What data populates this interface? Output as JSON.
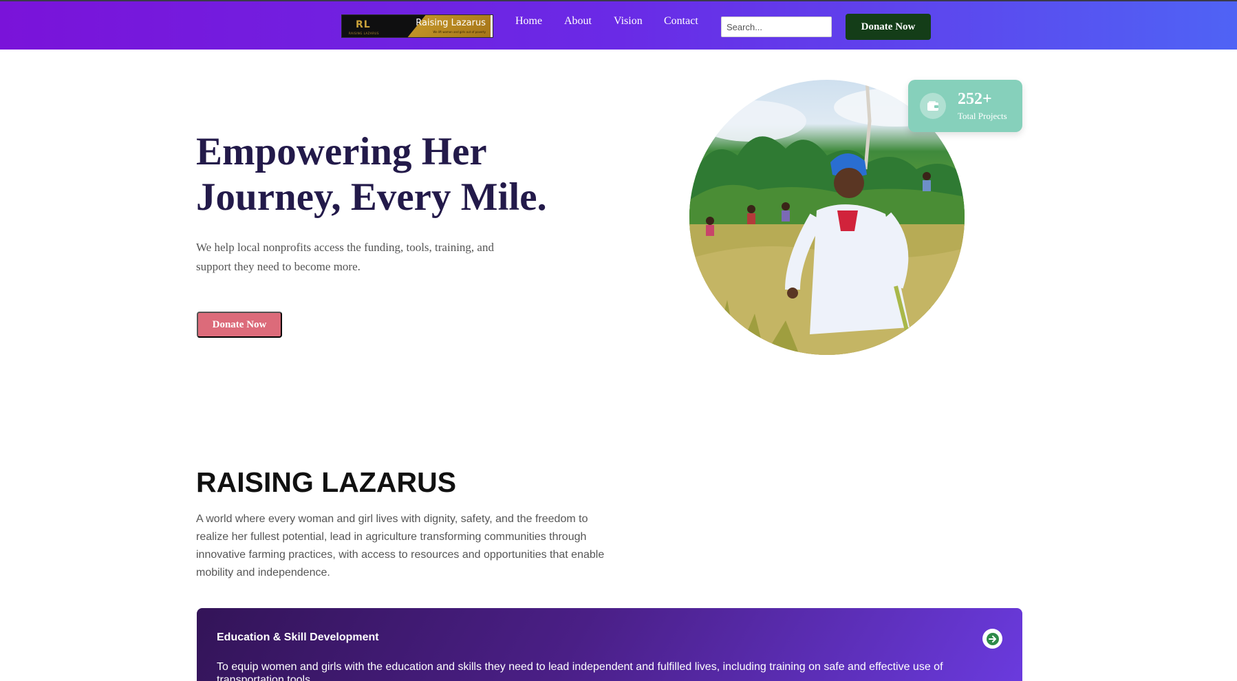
{
  "header": {
    "logo": {
      "mark": "RL",
      "mark_sub": "RAISING LAZARUS",
      "name": "Raising Lazarus",
      "tagline": "We lift women and girls out of poverty"
    },
    "nav": [
      "Home",
      "About",
      "Vision",
      "Contact"
    ],
    "search_placeholder": "Search...",
    "donate_label": "Donate Now"
  },
  "hero": {
    "title_line1": "Empowering Her",
    "title_line2": "Journey, Every Mile.",
    "subtitle_line1": "We help local nonprofits access the funding, tools, training, and",
    "subtitle_line2": "support they need to become more.",
    "donate_label": "Donate Now",
    "image_icon": "woman-in-rice-field-photo"
  },
  "stats": {
    "value": "252+",
    "label": "Total Projects",
    "icon": "wallet-icon"
  },
  "about": {
    "title": "RAISING LAZARUS",
    "lines": [
      "A world where every woman and girl lives with dignity, safety, and the freedom to",
      "realize her fullest potential, lead in agriculture transforming communities through",
      "innovative farming practices, with access to resources and opportunities that enable",
      "mobility and independence."
    ]
  },
  "card": {
    "title": "Education & Skill Development",
    "text": "To equip women and girls with the education and skills they need to lead independent and fulfilled lives, including training on safe and effective use of transportation tools.",
    "icon": "arrow-right-icon"
  },
  "colors": {
    "header_start": "#7a13d9",
    "header_end": "#4f63f5",
    "donate_top": "#143d18",
    "donate_hero": "#dc6b7a",
    "stat_bg": "#86d0bb",
    "title_text": "#231a4a",
    "card_start": "#331458",
    "card_end": "#6b3be0"
  }
}
